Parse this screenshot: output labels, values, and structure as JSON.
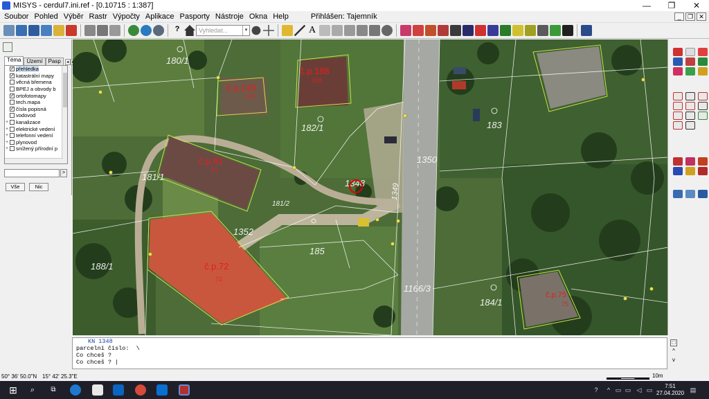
{
  "window": {
    "title": "MISYS - cerdul7.ini.ref - [0.10715 : 1:387]",
    "controls": [
      "—",
      "❐",
      "✕"
    ]
  },
  "menu": {
    "items": [
      "Soubor",
      "Pohled",
      "Výběr",
      "Rastr",
      "Výpočty",
      "Aplikace",
      "Pasporty",
      "Nástroje",
      "Okna",
      "Help"
    ],
    "logged_in": "Přihlášen: Tajemník",
    "mdi_controls": [
      "_",
      "❐",
      "✕"
    ]
  },
  "toolbar": {
    "search_placeholder": "Vyhledat...",
    "search_dropdown": "▾",
    "help_label": "?"
  },
  "left_panel": {
    "tabs": [
      "Téma",
      "Území",
      "Pasp"
    ],
    "tab_arrows": [
      "◂",
      "▸"
    ],
    "layers": [
      {
        "label": "přehledka",
        "checked": true,
        "expandable": false
      },
      {
        "label": "katastrální mapy",
        "checked": true,
        "expandable": false
      },
      {
        "label": "věcná břemena",
        "checked": false,
        "expandable": false
      },
      {
        "label": "BPEJ a obvody b",
        "checked": false,
        "expandable": false
      },
      {
        "label": "ortofotomapy",
        "checked": true,
        "expandable": false
      },
      {
        "label": "tech.mapa",
        "checked": false,
        "expandable": false
      },
      {
        "label": "čísla popisná",
        "checked": true,
        "expandable": false
      },
      {
        "label": "vodovod",
        "checked": false,
        "expandable": false
      },
      {
        "label": "kanalizace",
        "checked": false,
        "expandable": true
      },
      {
        "label": "elektrické vedení",
        "checked": false,
        "expandable": true
      },
      {
        "label": "telefonní vedení",
        "checked": false,
        "expandable": true
      },
      {
        "label": "plynovod",
        "checked": false,
        "expandable": true
      },
      {
        "label": "snížený přírodní p",
        "checked": false,
        "expandable": true
      }
    ],
    "filter_button": ">",
    "btn_all": "Vše",
    "btn_none": "Nic"
  },
  "map": {
    "parcel_labels": [
      "180/1",
      "182/1",
      "183",
      "1350",
      "181/1",
      "181/2",
      "1352",
      "185",
      "1349",
      "188/1",
      "1166/3",
      "184/1",
      "1348"
    ],
    "house_labels": [
      "č.p.149",
      "č.p.188",
      "č.p.81",
      "č.p.72",
      "č.p.75"
    ],
    "parcel_numbers_small": [
      "149",
      "188",
      "81",
      "72",
      "75"
    ]
  },
  "command": {
    "lines": [
      "KN 1348",
      "parcelní číslo:  \\",
      "Co chceš ?",
      "Co chceš ? |"
    ]
  },
  "status": {
    "lat": "50° 36' 50.0\"N",
    "lon": "15° 42' 25.3\"E",
    "scale": "10m"
  },
  "taskbar": {
    "time": "7:51",
    "date": "27.04.2020"
  },
  "colors": {
    "parcel_line": "#ffffff",
    "building_outline": "#c8e04a",
    "house_label": "#e02020",
    "selection_marker": "#e00000"
  }
}
